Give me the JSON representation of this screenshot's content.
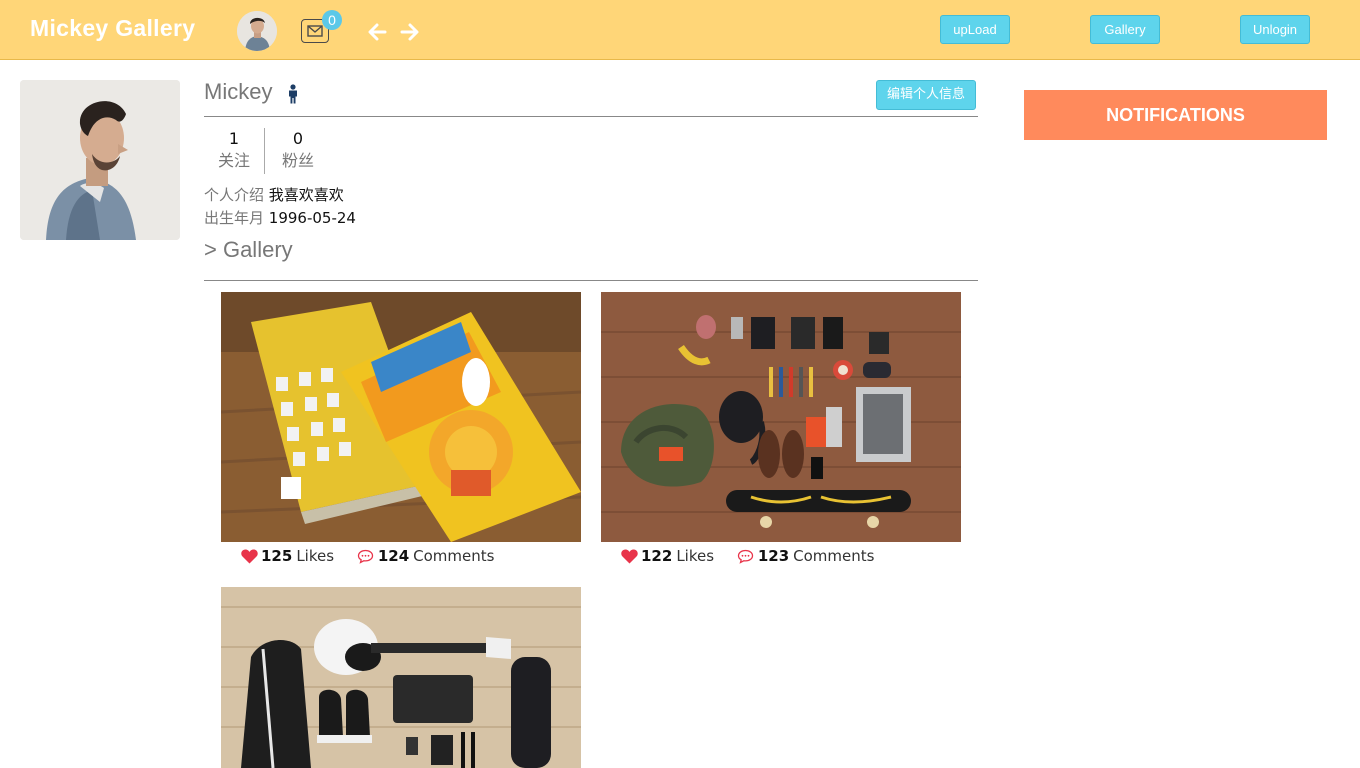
{
  "header": {
    "brand": "Mickey Gallery",
    "message_count": "0",
    "buttons": {
      "upload": "upLoad",
      "gallery": "Gallery",
      "unlogin": "Unlogin"
    }
  },
  "profile": {
    "name": "Mickey",
    "edit_label": "编辑个人信息",
    "stats": [
      {
        "value": "1",
        "label": "关注"
      },
      {
        "value": "0",
        "label": "粉丝"
      }
    ],
    "intro_label": "个人介绍",
    "intro_value": "我喜欢喜欢",
    "birth_label": "出生年月",
    "birth_value": "1996-05-24"
  },
  "gallery": {
    "title": "> Gallery",
    "items": [
      {
        "likes": "125",
        "likes_label": "Likes",
        "comments": "124",
        "comments_label": "Comments"
      },
      {
        "likes": "122",
        "likes_label": "Likes",
        "comments": "123",
        "comments_label": "Comments"
      },
      {
        "likes": "",
        "likes_label": "",
        "comments": "",
        "comments_label": ""
      }
    ]
  },
  "notifications": {
    "title": "NOTIFICATIONS"
  },
  "colors": {
    "header_bg": "#ffd678",
    "button_bg": "#5ed4ec",
    "notifications_bg": "#ff8a5c",
    "heart": "#e8344a"
  }
}
